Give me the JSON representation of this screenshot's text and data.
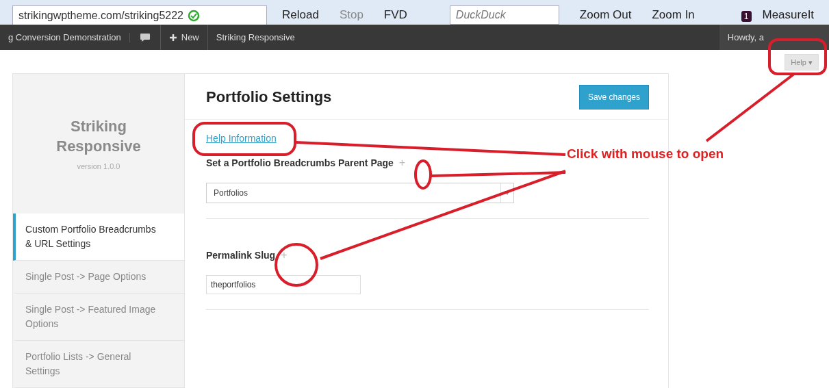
{
  "browser_toolbar": {
    "address": "strikingwptheme.com/striking5222",
    "buttons": [
      {
        "label": "Reload",
        "disabled": false
      },
      {
        "label": "Stop",
        "disabled": true
      },
      {
        "label": "FVD",
        "disabled": false
      }
    ],
    "search": "DuckDuck",
    "zoom_buttons": [
      "Zoom Out",
      "Zoom In"
    ],
    "extension_badge": "1",
    "extension": "MeasureIt"
  },
  "admin_bar": {
    "site": "g Conversion Demonstration",
    "new": "New",
    "theme": "Striking Responsive",
    "greeting": "Howdy, a"
  },
  "help_tab": {
    "label": "Help",
    "caret": "▾"
  },
  "sidebar": {
    "title": "Striking Responsive",
    "version": "version 1.0.0",
    "items": [
      {
        "label": "Custom Portfolio Breadcrumbs & URL Settings",
        "selected": true
      },
      {
        "label": "Single Post -> Page Options",
        "selected": false
      },
      {
        "label": "Single Post -> Featured Image Options",
        "selected": false
      },
      {
        "label": "Portfolio Lists -> General Settings",
        "selected": false
      }
    ]
  },
  "main": {
    "title": "Portfolio Settings",
    "save_button": "Save changes",
    "help_link": "Help Information",
    "fields": [
      {
        "kind": "select",
        "label": "Set a Portfolio Breadcrumbs Parent Page",
        "toggle": "+",
        "value": "Portfolios"
      },
      {
        "kind": "text",
        "label": "Permalink Slug",
        "toggle": "+",
        "value": "theportfolios"
      }
    ]
  },
  "annotation": {
    "text": "Click with mouse to open"
  }
}
